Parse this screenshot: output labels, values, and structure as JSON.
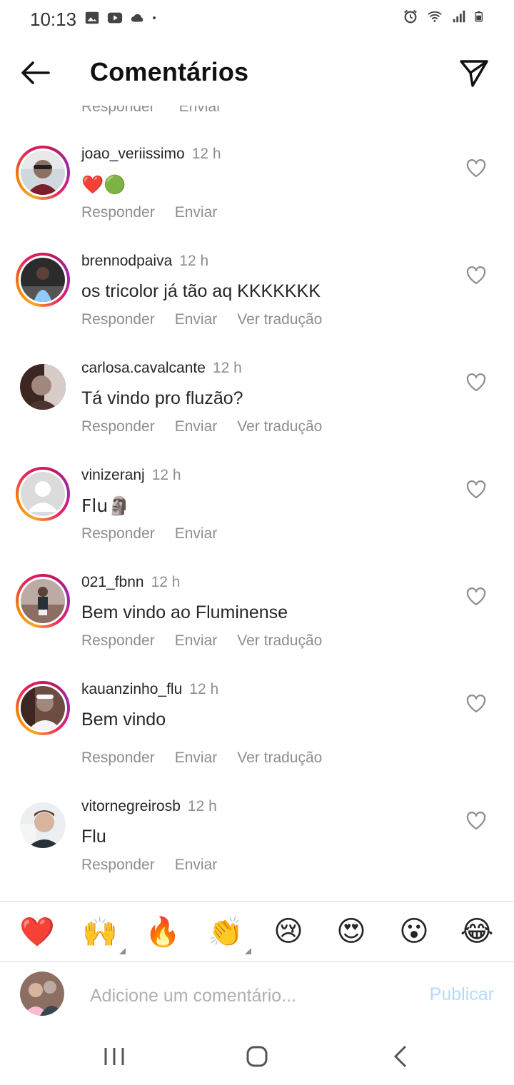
{
  "status_bar": {
    "time": "10:13",
    "icons_left": [
      "image-icon",
      "youtube-icon",
      "cloud-icon",
      "dot-icon"
    ],
    "icons_right": [
      "alarm-icon",
      "wifi-icon",
      "signal-icon",
      "battery-icon"
    ]
  },
  "header": {
    "title": "Comentários"
  },
  "partial_actions": {
    "reply": "Responder",
    "send": "Enviar"
  },
  "comments": [
    {
      "username": "joao_veriissimo",
      "time": "12 h",
      "text": "❤️🟢",
      "reply": "Responder",
      "send": "Enviar",
      "translate": ""
    },
    {
      "username": "brennodpaiva",
      "time": "12 h",
      "text": "os tricolor já tão aq KKKKKKK",
      "reply": "Responder",
      "send": "Enviar",
      "translate": "Ver tradução"
    },
    {
      "username": "carlosa.cavalcante",
      "time": "12 h",
      "text": "Tá vindo pro fluzão?",
      "reply": "Responder",
      "send": "Enviar",
      "translate": "Ver tradução"
    },
    {
      "username": "vinizeranj",
      "time": "12 h",
      "text": "Flu🗿",
      "reply": "Responder",
      "send": "Enviar",
      "translate": ""
    },
    {
      "username": "021_fbnn",
      "time": "12 h",
      "text": "Bem vindo ao Fluminense",
      "reply": "Responder",
      "send": "Enviar",
      "translate": "Ver tradução"
    },
    {
      "username": "kauanzinho_flu",
      "time": "12 h",
      "text": "Bem vindo",
      "reply": "Responder",
      "send": "Enviar",
      "translate": "Ver tradução"
    },
    {
      "username": "vitornegreirosb",
      "time": "12 h",
      "text": "Flu",
      "reply": "Responder",
      "send": "Enviar",
      "translate": ""
    }
  ],
  "emoji_bar": [
    "❤️",
    "🙌",
    "🔥",
    "👏",
    "😢",
    "😍",
    "😮",
    "😂"
  ],
  "composer": {
    "placeholder": "Adicione um comentário...",
    "publish_label": "Publicar"
  },
  "colors": {
    "text_primary": "#262626",
    "text_secondary": "#8e8e8e",
    "publish_disabled": "#b3dbff",
    "story_ring_start": "#f9a825",
    "story_ring_end": "#c2185b"
  }
}
